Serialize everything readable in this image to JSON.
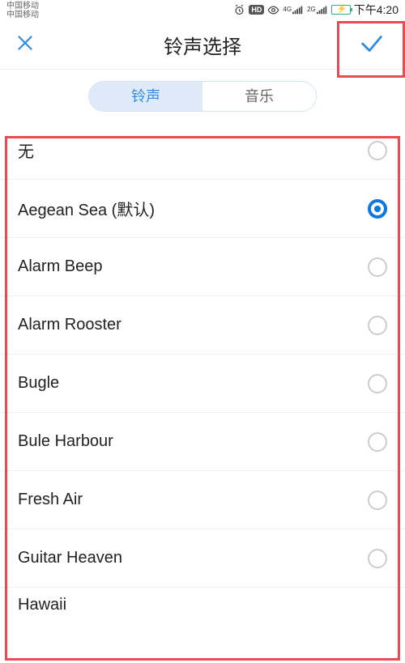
{
  "status": {
    "carrier1": "中国移动",
    "carrier2": "中国移动",
    "hd": "HD",
    "net1": "4G",
    "net2": "2G",
    "time": "下午4:20"
  },
  "header": {
    "title": "铃声选择"
  },
  "tabs": {
    "ringtone": "铃声",
    "music": "音乐"
  },
  "list": {
    "items": [
      {
        "label": "无",
        "selected": false
      },
      {
        "label": "Aegean Sea (默认)",
        "selected": true
      },
      {
        "label": "Alarm Beep",
        "selected": false
      },
      {
        "label": "Alarm Rooster",
        "selected": false
      },
      {
        "label": "Bugle",
        "selected": false
      },
      {
        "label": "Bule Harbour",
        "selected": false
      },
      {
        "label": "Fresh Air",
        "selected": false
      },
      {
        "label": "Guitar Heaven",
        "selected": false
      },
      {
        "label": "Hawaii",
        "selected": false
      }
    ]
  }
}
